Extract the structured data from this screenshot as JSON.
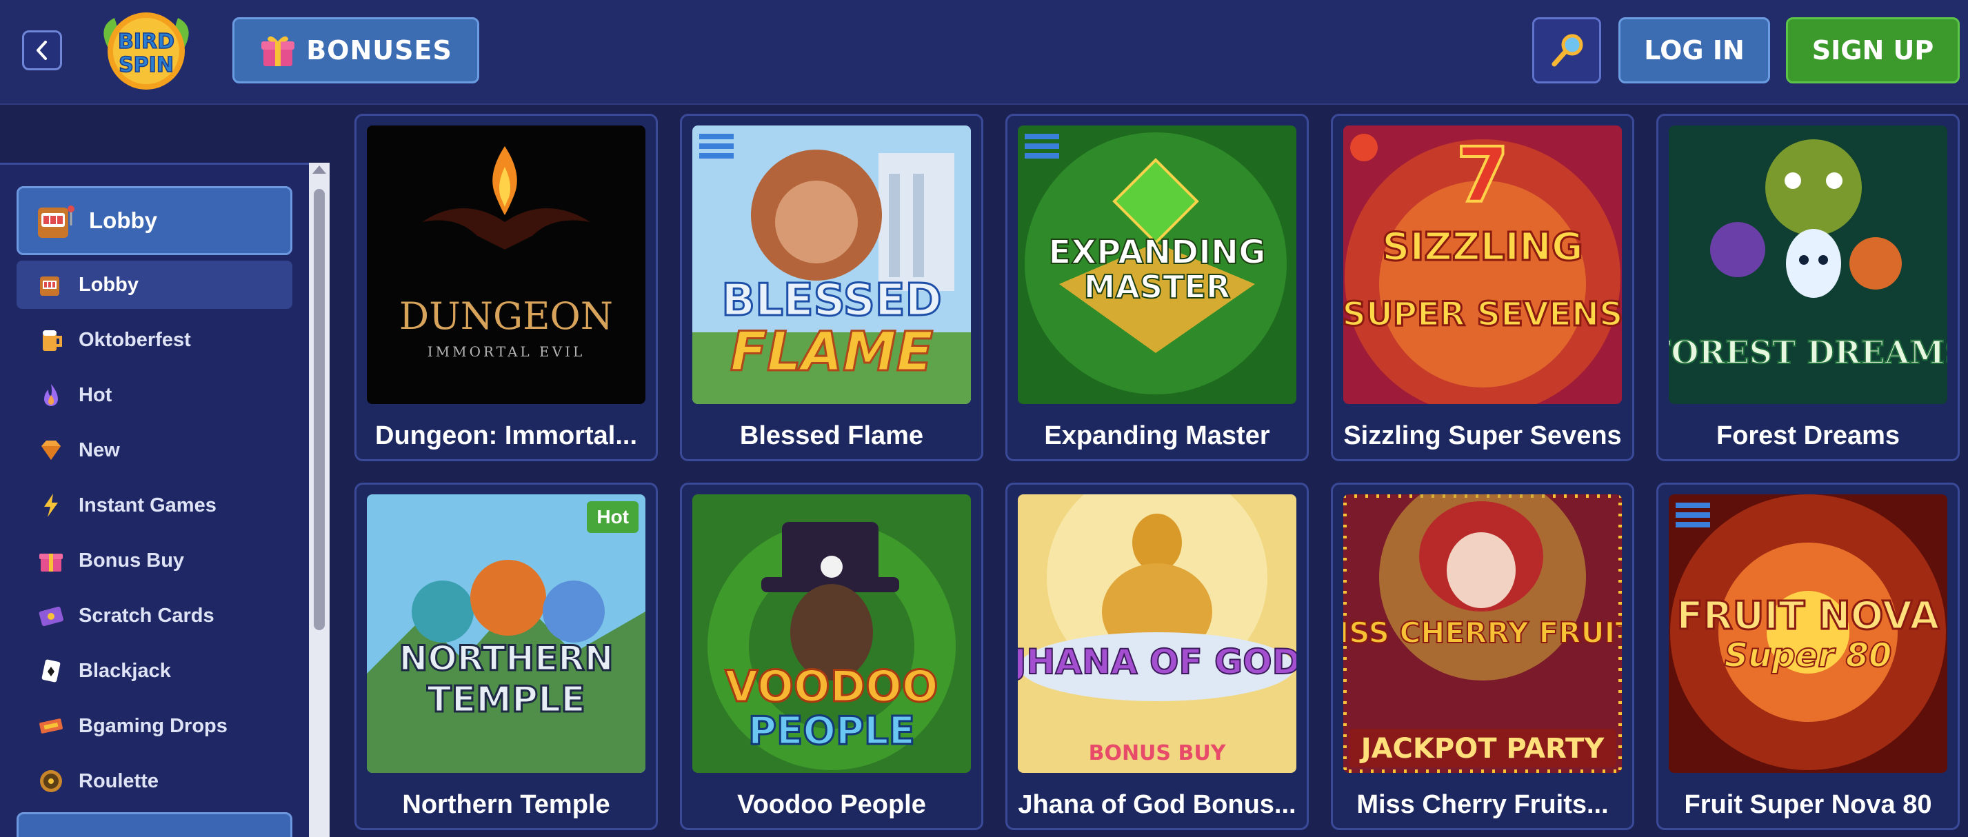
{
  "header": {
    "logo_text": "BIRD SPIN",
    "bonuses_label": "BONUSES",
    "login_label": "LOG IN",
    "signup_label": "SIGN UP"
  },
  "sidebar": {
    "section_title": "Lobby",
    "items": [
      {
        "label": "Lobby",
        "icon": "slot-machine-icon"
      },
      {
        "label": "Oktoberfest",
        "icon": "beer-mug-icon"
      },
      {
        "label": "Hot",
        "icon": "flame-icon"
      },
      {
        "label": "New",
        "icon": "diamond-icon"
      },
      {
        "label": "Instant Games",
        "icon": "lightning-icon"
      },
      {
        "label": "Bonus Buy",
        "icon": "gift-icon"
      },
      {
        "label": "Scratch Cards",
        "icon": "scratch-card-icon"
      },
      {
        "label": "Blackjack",
        "icon": "playing-card-icon"
      },
      {
        "label": "Bgaming Drops",
        "icon": "ticket-icon"
      },
      {
        "label": "Roulette",
        "icon": "roulette-icon"
      }
    ]
  },
  "games": [
    {
      "title": "Dungeon: Immortal...",
      "art": "DUNGEON",
      "art_sub": "IMMORTAL EVIL"
    },
    {
      "title": "Blessed Flame",
      "art": "BLESSED",
      "art_sub": "FLAME"
    },
    {
      "title": "Expanding Master",
      "art": "EXPANDING",
      "art_sub": "MASTER"
    },
    {
      "title": "Sizzling Super Sevens",
      "art": "SIZZLING",
      "art_sub": "SUPER SEVENS"
    },
    {
      "title": "Forest Dreams",
      "art": "FOREST DREAMS",
      "art_sub": ""
    },
    {
      "title": "Northern Temple",
      "art": "NORTHERN",
      "art_sub": "TEMPLE",
      "badge": "Hot"
    },
    {
      "title": "Voodoo People",
      "art": "VOODOO",
      "art_sub": "PEOPLE"
    },
    {
      "title": "Jhana of God Bonus...",
      "art": "JHANA OF GOD",
      "art_sub": "BONUS BUY"
    },
    {
      "title": "Miss Cherry Fruits...",
      "art": "MISS CHERRY FRUITS",
      "art_sub": "JACKPOT PARTY"
    },
    {
      "title": "Fruit Super Nova 80",
      "art": "FRUIT NOVA",
      "art_sub": "Super 80"
    }
  ],
  "colors": {
    "background": "#1b2252",
    "header": "#232c6b",
    "accent_blue": "#3c6db3",
    "accent_green": "#3c9a2d"
  }
}
